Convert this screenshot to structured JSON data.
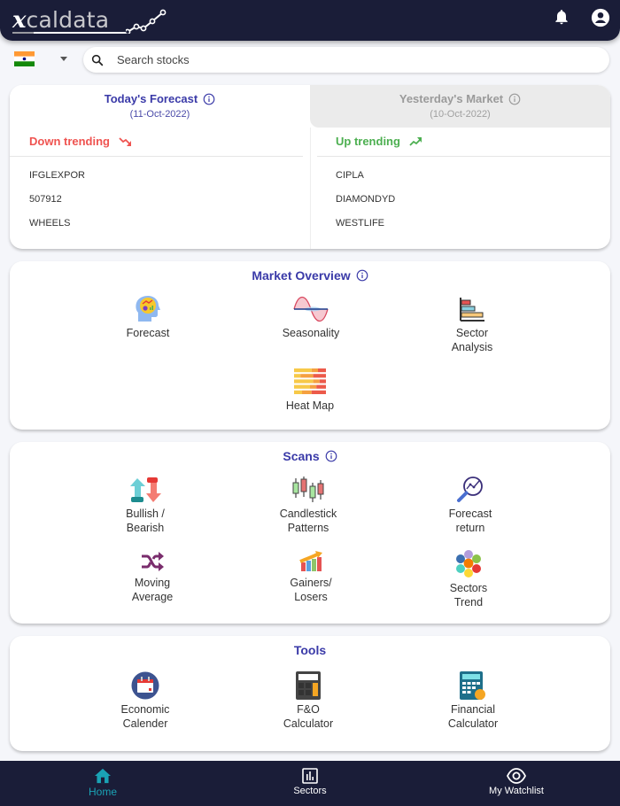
{
  "header": {
    "logo_prefix": "x",
    "logo_text": "caldata",
    "icons": [
      "bell-icon",
      "account-icon"
    ]
  },
  "country": {
    "flag": "india-flag-icon",
    "selected": "India"
  },
  "search": {
    "placeholder": "Search stocks",
    "value": ""
  },
  "forecast_card": {
    "today": {
      "title": "Today's Forecast",
      "date": "(11-Oct-2022)",
      "trend_label": "Down trending",
      "trend_color": "#ef5350",
      "stocks": [
        "IFGLEXPOR",
        "507912",
        "WHEELS"
      ]
    },
    "yesterday": {
      "title": "Yesterday's Market",
      "date": "(10-Oct-2022)",
      "trend_label": "Up trending",
      "trend_color": "#4caf50",
      "stocks": [
        "CIPLA",
        "DIAMONDYD",
        "WESTLIFE"
      ]
    }
  },
  "market_overview": {
    "title": "Market Overview",
    "items": [
      {
        "label": "Forecast",
        "icon": "forecast-head-icon"
      },
      {
        "label": "Seasonality",
        "icon": "sine-wave-icon"
      },
      {
        "label": "Sector\nAnalysis",
        "icon": "bar-chart-icon"
      },
      {
        "label": "Heat Map",
        "icon": "heatmap-icon"
      }
    ]
  },
  "scans": {
    "title": "Scans",
    "items": [
      {
        "label": "Bullish /\nBearish",
        "icon": "bull-bear-icon"
      },
      {
        "label": "Candlestick\nPatterns",
        "icon": "candlestick-icon"
      },
      {
        "label": "Forecast\nreturn",
        "icon": "magnifier-chart-icon"
      },
      {
        "label": "Moving\nAverage",
        "icon": "shuffle-icon"
      },
      {
        "label": "Gainers/\nLosers",
        "icon": "growth-chart-icon"
      },
      {
        "label": "Sectors\nTrend",
        "icon": "hexagon-cluster-icon"
      }
    ]
  },
  "tools": {
    "title": "Tools",
    "items": [
      {
        "label": "Economic\nCalender",
        "icon": "calendar-icon"
      },
      {
        "label": "F&O\nCalculator",
        "icon": "calculator-icon"
      },
      {
        "label": "Financial\nCalculator",
        "icon": "financial-calculator-icon"
      }
    ]
  },
  "bottom_nav": {
    "items": [
      {
        "label": "Home",
        "active": true
      },
      {
        "label": "Sectors",
        "active": false
      },
      {
        "label": "My Watchlist",
        "active": false
      }
    ],
    "active_color": "#1aa3b5"
  },
  "colors": {
    "navy": "#1a1d38",
    "title_blue": "#3a3aa8"
  }
}
